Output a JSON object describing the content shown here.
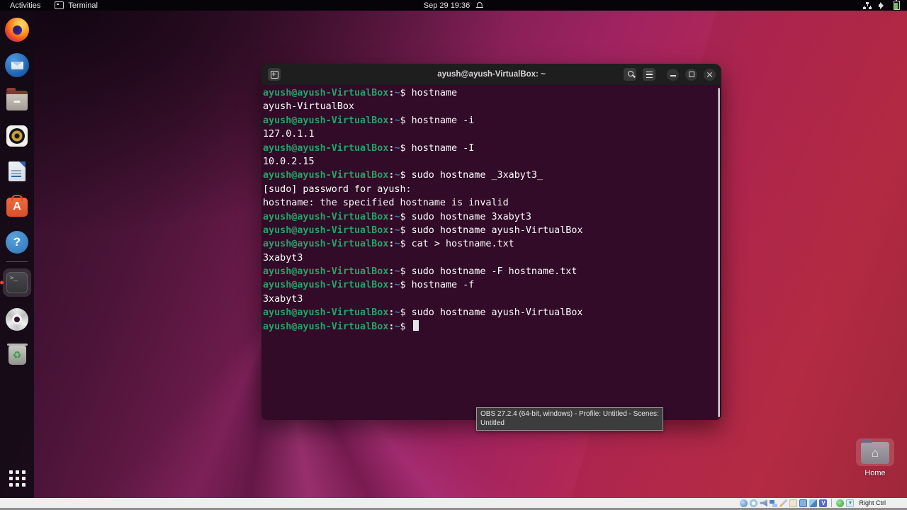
{
  "top_bar": {
    "activities": "Activities",
    "focused_app": "Terminal",
    "clock": "Sep 29 19:36",
    "status_icons": [
      "notification-bell-icon",
      "network-icon",
      "volume-icon",
      "battery-icon"
    ]
  },
  "dock": {
    "icons": [
      "firefox",
      "thunderbird",
      "files",
      "rhythmbox",
      "libreoffice-writer",
      "ubuntu-software",
      "help",
      "terminal",
      "optical-disc",
      "trash",
      "show-applications"
    ],
    "active_app": "terminal"
  },
  "terminal": {
    "title": "ayush@ayush-VirtualBox: ~",
    "titlebar_icons": [
      "new-tab-icon",
      "search-icon",
      "menu-icon",
      "minimize-icon",
      "maximize-icon",
      "close-icon"
    ],
    "prompt": {
      "user": "ayush@ayush-VirtualBox",
      "colon": ":",
      "path": "~",
      "dollar": "$"
    },
    "colors": {
      "background": "#310b27",
      "prompt_user": "#26a269",
      "prompt_path": "#4d76b3",
      "text": "#fdfdfd"
    },
    "lines": [
      {
        "prompt": true,
        "text": "hostname"
      },
      {
        "prompt": false,
        "text": "ayush-VirtualBox"
      },
      {
        "prompt": true,
        "text": "hostname -i"
      },
      {
        "prompt": false,
        "text": "127.0.1.1"
      },
      {
        "prompt": true,
        "text": "hostname -I"
      },
      {
        "prompt": false,
        "text": "10.0.2.15"
      },
      {
        "prompt": true,
        "text": "sudo hostname _3xabyt3_"
      },
      {
        "prompt": false,
        "text": "[sudo] password for ayush:"
      },
      {
        "prompt": false,
        "text": "hostname: the specified hostname is invalid"
      },
      {
        "prompt": true,
        "text": "sudo hostname 3xabyt3"
      },
      {
        "prompt": true,
        "text": "sudo hostname ayush-VirtualBox"
      },
      {
        "prompt": true,
        "text": "cat > hostname.txt"
      },
      {
        "prompt": false,
        "text": "3xabyt3"
      },
      {
        "prompt": true,
        "text": "sudo hostname -F hostname.txt"
      },
      {
        "prompt": true,
        "text": "hostname -f"
      },
      {
        "prompt": false,
        "text": "3xabyt3"
      },
      {
        "prompt": true,
        "text": "sudo hostname ayush-VirtualBox"
      },
      {
        "prompt": true,
        "text": "",
        "cursor": true
      }
    ]
  },
  "obs_tooltip": {
    "text": "OBS 27.2.4 (64-bit, windows) - Profile: Untitled - Scenes: Untitled"
  },
  "desktop": {
    "home_label": "Home"
  },
  "vbox_bar": {
    "icons": [
      "hard-disk-icon",
      "optical-disc-icon",
      "audio-icon",
      "network-icon",
      "usb-icon",
      "shared-folders-icon",
      "display-icon",
      "video-capture-icon",
      "features-icon",
      "mouse-integration-icon",
      "keyboard-icon"
    ],
    "host_key": "Right Ctrl"
  }
}
